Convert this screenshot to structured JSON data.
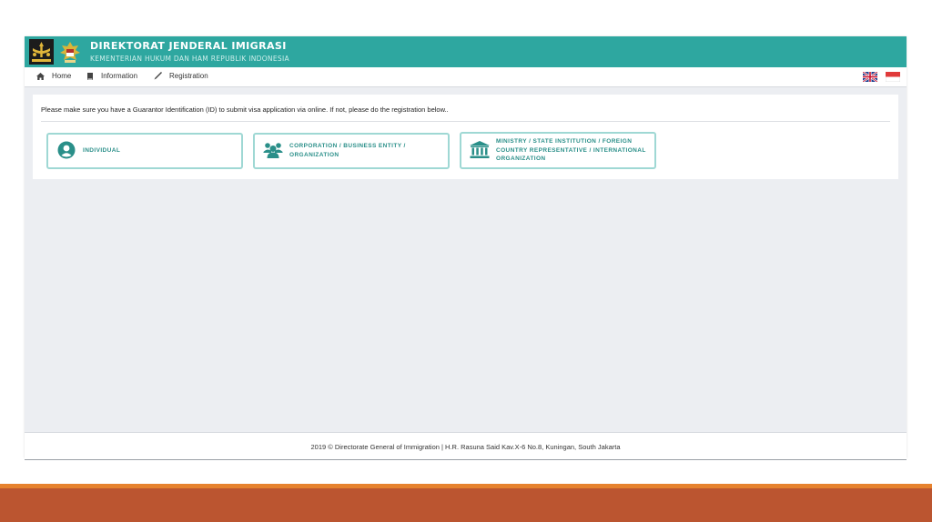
{
  "header": {
    "title": "DIREKTORAT JENDERAL IMIGRASI",
    "subtitle": "KEMENTERIAN HUKUM DAN HAM REPUBLIK INDONESIA",
    "color": "#2ea7a0",
    "logo1_text": "IMIGRASI",
    "logo2_text": "GARUDA"
  },
  "nav": {
    "home": "Home",
    "information": "Information",
    "registration": "Registration",
    "icons": [
      "home-icon",
      "book-icon",
      "pen-icon"
    ],
    "flags": [
      "uk-flag-icon",
      "indonesia-flag-icon"
    ]
  },
  "main": {
    "notice": "Please make sure you have a Guarantor Identification (ID) to submit visa application via online. If not, please do the registration below..",
    "options": [
      {
        "line1": "INDIVIDUAL",
        "line2": "",
        "line3": "",
        "icon": "user-circle-icon"
      },
      {
        "line1": "CORPORATION / BUSINESS ENTITY /",
        "line2": "ORGANIZATION",
        "line3": "",
        "icon": "users-group-icon"
      },
      {
        "line1": "MINISTRY / STATE INSTITUTION / FOREIGN",
        "line2": "COUNTRY REPRESENTATIVE / INTERNATIONAL",
        "line3": "ORGANIZATION",
        "icon": "institution-icon"
      }
    ]
  },
  "footer": {
    "text": "2019 © Directorate General of Immigration | H.R. Rasuna Said Kav.X-6 No.8, Kuningan, South Jakarta"
  },
  "colors": {
    "accent": "#2ea7a0",
    "option_text": "#2a8f89",
    "slide_bar_orange": "#e6822e",
    "slide_bar_brown": "#bb5530"
  }
}
